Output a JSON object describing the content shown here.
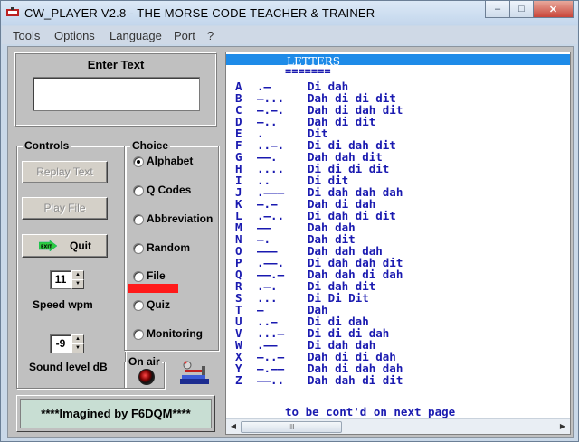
{
  "window": {
    "title": "CW_PLAYER  V2.8 - THE  MORSE CODE  TEACHER  &  TRAINER",
    "minimize": "–",
    "maximize": "□",
    "close": "✕"
  },
  "menu": [
    "Tools",
    "Options",
    "Language",
    "Port",
    "?"
  ],
  "enter_text": {
    "title": "Enter Text",
    "value": ""
  },
  "controls": {
    "label": "Controls",
    "replay": "Replay Text",
    "play_file": "Play File",
    "quit": "Quit",
    "exit_badge": "EXIT",
    "speed_value": "11",
    "speed_label": "Speed   wpm",
    "sound_value": "-9",
    "sound_label": "Sound level dB"
  },
  "choice": {
    "label": "Choice",
    "selected": "Alphabet",
    "options": [
      "Alphabet",
      "Q Codes",
      "Abbreviation",
      "Random",
      "File",
      "Quiz",
      "Monitoring"
    ]
  },
  "onair": {
    "label": "On air"
  },
  "credit": "****Imagined by F6DQM****",
  "viewer": {
    "title": "LETTERS",
    "rule": "=======",
    "rows": [
      {
        "letter": "A",
        "code": ".–",
        "sound": "Di dah"
      },
      {
        "letter": "B",
        "code": "–...",
        "sound": "Dah di di dit"
      },
      {
        "letter": "C",
        "code": "–.–.",
        "sound": "Dah di dah dit"
      },
      {
        "letter": "D",
        "code": "–..",
        "sound": "Dah di dit"
      },
      {
        "letter": "E",
        "code": ".",
        "sound": "Dit"
      },
      {
        "letter": "F",
        "code": "..–.",
        "sound": "Di di dah dit"
      },
      {
        "letter": "G",
        "code": "––.",
        "sound": "Dah dah dit"
      },
      {
        "letter": "H",
        "code": "....",
        "sound": "Di di di dit"
      },
      {
        "letter": "I",
        "code": "..",
        "sound": "Di dit"
      },
      {
        "letter": "J",
        "code": ".–––",
        "sound": "Di dah dah dah"
      },
      {
        "letter": "K",
        "code": "–.–",
        "sound": "Dah di dah"
      },
      {
        "letter": "L",
        "code": ".–..",
        "sound": "Di dah di dit"
      },
      {
        "letter": "M",
        "code": "––",
        "sound": "Dah dah"
      },
      {
        "letter": "N",
        "code": "–.",
        "sound": "Dah dit"
      },
      {
        "letter": "O",
        "code": "–––",
        "sound": "Dah dah dah"
      },
      {
        "letter": "P",
        "code": ".––.",
        "sound": "Di dah dah dit"
      },
      {
        "letter": "Q",
        "code": "––.–",
        "sound": "Dah dah di dah"
      },
      {
        "letter": "R",
        "code": ".–.",
        "sound": "Di dah dit"
      },
      {
        "letter": "S",
        "code": "...",
        "sound": "Di Di Dit"
      },
      {
        "letter": "T",
        "code": "–",
        "sound": "Dah"
      },
      {
        "letter": "U",
        "code": "..–",
        "sound": "Di di dah"
      },
      {
        "letter": "V",
        "code": "...–",
        "sound": "Di di di dah"
      },
      {
        "letter": "W",
        "code": ".––",
        "sound": "Di dah dah"
      },
      {
        "letter": "X",
        "code": "–..–",
        "sound": "Dah di di dah"
      },
      {
        "letter": "Y",
        "code": "–.––",
        "sound": "Dah di dah dah"
      },
      {
        "letter": "Z",
        "code": "––..",
        "sound": "Dah dah di dit"
      }
    ],
    "footer": "to be cont'd on next page",
    "scroll_left": "◀",
    "scroll_right": "▶",
    "thumb_grip": "III"
  },
  "colors": {
    "morse_text": "#1a1ab0",
    "header_bar": "#1e8be8",
    "file_indicator": "#ff1a1a",
    "credit_bg": "#c8ded3"
  }
}
